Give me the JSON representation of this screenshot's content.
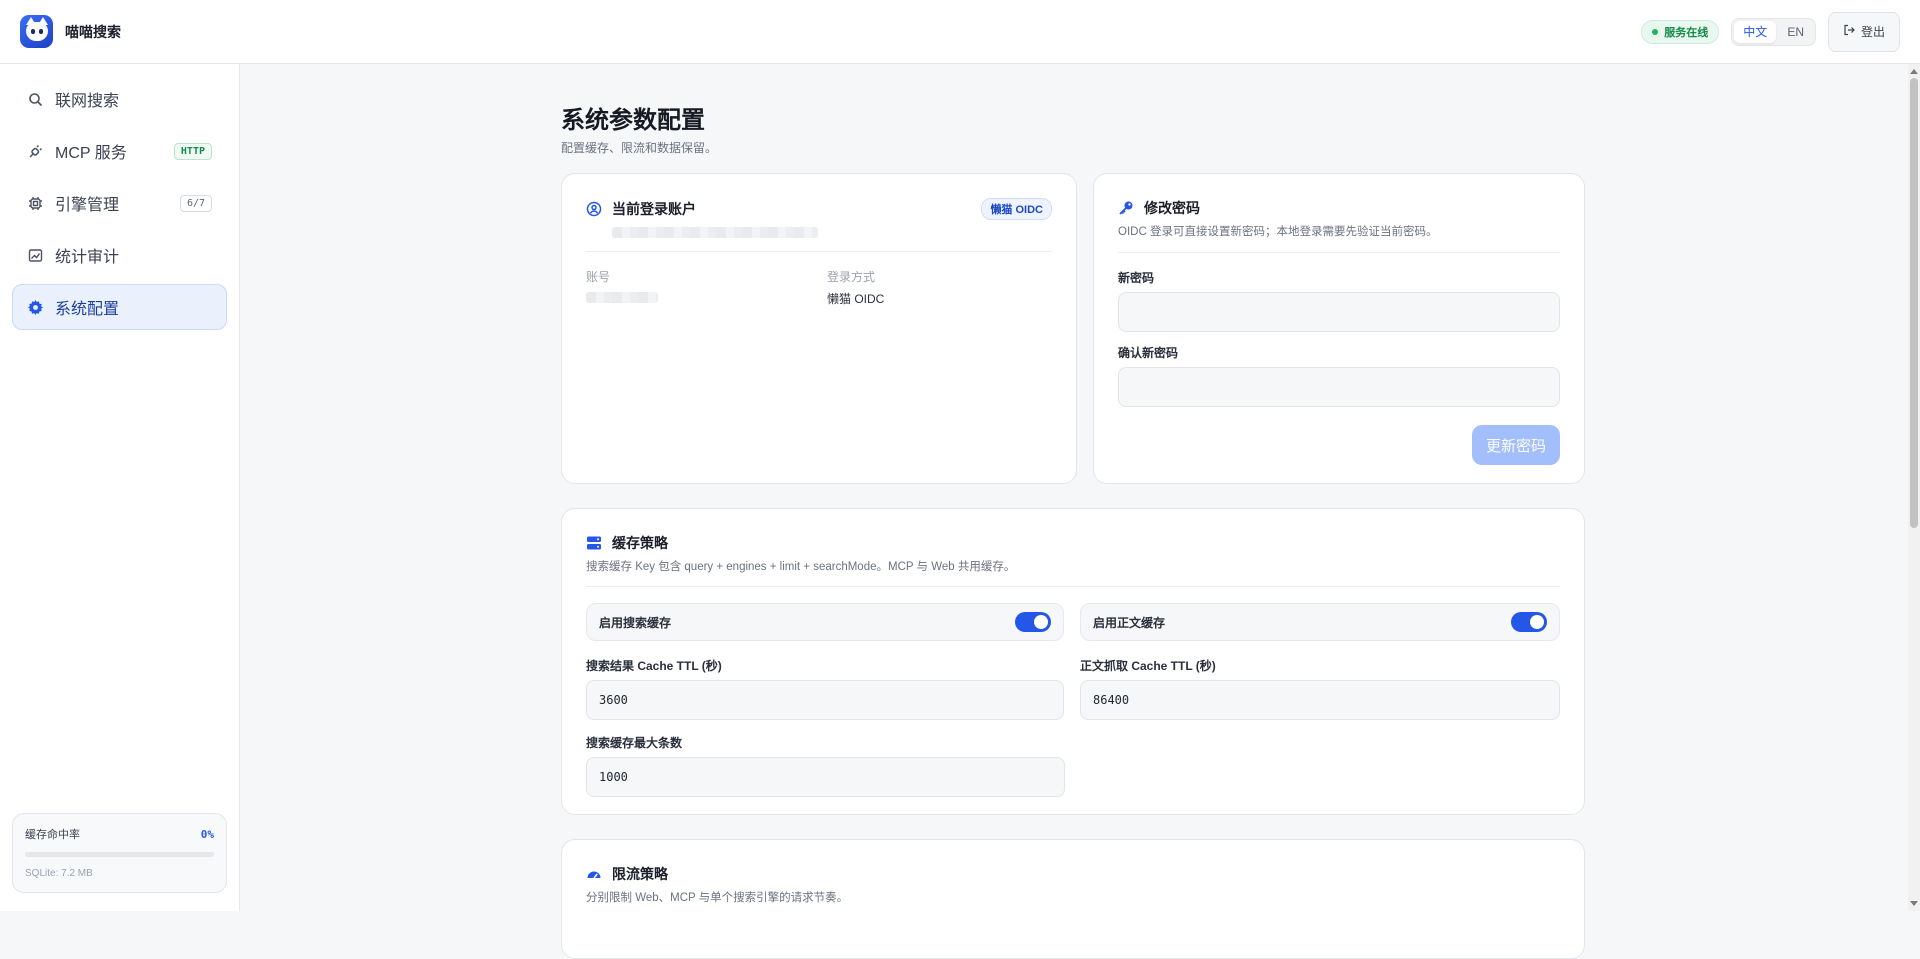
{
  "header": {
    "app_title": "喵喵搜索",
    "status": "服务在线",
    "lang_zh": "中文",
    "lang_en": "EN",
    "logout": "登出"
  },
  "sidebar": {
    "items": [
      {
        "label": "联网搜索",
        "icon": "search-icon"
      },
      {
        "label": "MCP 服务",
        "icon": "plug-icon",
        "badge": "HTTP"
      },
      {
        "label": "引擎管理",
        "icon": "chip-icon",
        "badge": "6/7"
      },
      {
        "label": "统计审计",
        "icon": "image-chart-icon"
      },
      {
        "label": "系统配置",
        "icon": "gear-icon",
        "active": true
      }
    ],
    "cache": {
      "label": "缓存命中率",
      "value": "0%",
      "hit_rate": 0,
      "footer": "SQLite: 7.2 MB"
    }
  },
  "page": {
    "title": "系统参数配置",
    "subtitle": "配置缓存、限流和数据保留。"
  },
  "account": {
    "title": "当前登录账户",
    "tag": "懒猫 OIDC",
    "account_label": "账号",
    "login_method_label": "登录方式",
    "login_method_value": "懒猫 OIDC"
  },
  "password": {
    "title": "修改密码",
    "desc": "OIDC 登录可直接设置新密码；本地登录需要先验证当前密码。",
    "new_label": "新密码",
    "confirm_label": "确认新密码",
    "submit": "更新密码"
  },
  "cache_policy": {
    "title": "缓存策略",
    "desc": "搜索缓存 Key 包含 query + engines + limit + searchMode。MCP 与 Web 共用缓存。",
    "enable_search_cache": "启用搜索缓存",
    "enable_content_cache": "启用正文缓存",
    "search_ttl_label": "搜索结果 Cache TTL (秒)",
    "search_ttl_value": "3600",
    "content_ttl_label": "正文抓取 Cache TTL (秒)",
    "content_ttl_value": "86400",
    "max_entries_label": "搜索缓存最大条数",
    "max_entries_value": "1000"
  },
  "rate_limit": {
    "title": "限流策略",
    "desc": "分别限制 Web、MCP 与单个搜索引擎的请求节奏。"
  }
}
